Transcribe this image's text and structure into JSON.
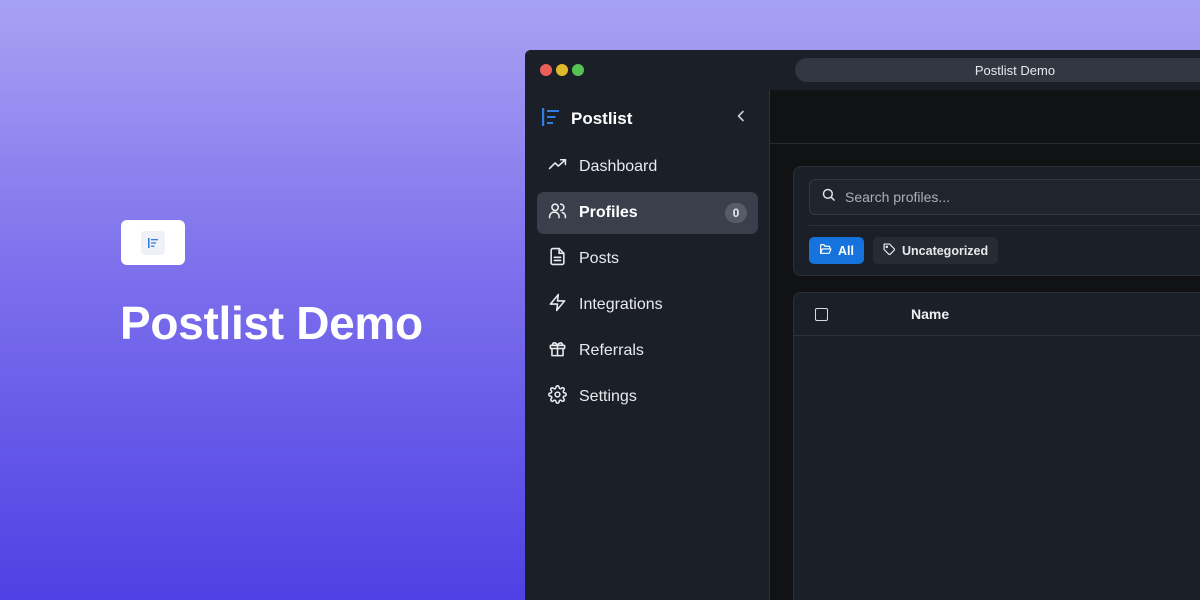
{
  "hero": {
    "title": "Postlist Demo"
  },
  "window": {
    "address": "Postlist Demo"
  },
  "sidebar": {
    "brand": "Postlist",
    "items": [
      {
        "label": "Dashboard",
        "icon": "trending-up-icon"
      },
      {
        "label": "Profiles",
        "icon": "users-icon",
        "badge": "0",
        "active": true
      },
      {
        "label": "Posts",
        "icon": "file-text-icon"
      },
      {
        "label": "Integrations",
        "icon": "zap-icon"
      },
      {
        "label": "Referrals",
        "icon": "gift-icon"
      },
      {
        "label": "Settings",
        "icon": "gear-icon"
      }
    ]
  },
  "filters": {
    "search_placeholder": "Search profiles...",
    "chips": [
      {
        "label": "All",
        "icon": "folder-open-icon",
        "active": true
      },
      {
        "label": "Uncategorized",
        "icon": "tag-icon"
      }
    ]
  },
  "table": {
    "columns": [
      "Name"
    ]
  },
  "colors": {
    "accent": "#1673de",
    "sidebar_bg": "#1b1f27",
    "active_item_bg": "#3a404b",
    "brand_icon": "#2f7ee6"
  }
}
